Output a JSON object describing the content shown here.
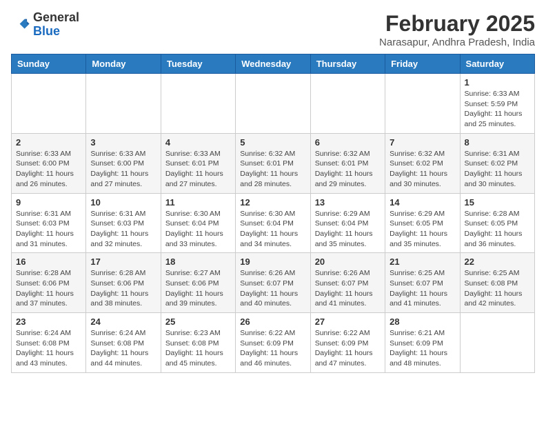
{
  "header": {
    "logo": {
      "general": "General",
      "blue": "Blue"
    },
    "title": "February 2025",
    "location": "Narasapur, Andhra Pradesh, India"
  },
  "weekdays": [
    "Sunday",
    "Monday",
    "Tuesday",
    "Wednesday",
    "Thursday",
    "Friday",
    "Saturday"
  ],
  "weeks": [
    [
      {
        "day": "",
        "info": ""
      },
      {
        "day": "",
        "info": ""
      },
      {
        "day": "",
        "info": ""
      },
      {
        "day": "",
        "info": ""
      },
      {
        "day": "",
        "info": ""
      },
      {
        "day": "",
        "info": ""
      },
      {
        "day": "1",
        "info": "Sunrise: 6:33 AM\nSunset: 5:59 PM\nDaylight: 11 hours\nand 25 minutes."
      }
    ],
    [
      {
        "day": "2",
        "info": "Sunrise: 6:33 AM\nSunset: 6:00 PM\nDaylight: 11 hours\nand 26 minutes."
      },
      {
        "day": "3",
        "info": "Sunrise: 6:33 AM\nSunset: 6:00 PM\nDaylight: 11 hours\nand 27 minutes."
      },
      {
        "day": "4",
        "info": "Sunrise: 6:33 AM\nSunset: 6:01 PM\nDaylight: 11 hours\nand 27 minutes."
      },
      {
        "day": "5",
        "info": "Sunrise: 6:32 AM\nSunset: 6:01 PM\nDaylight: 11 hours\nand 28 minutes."
      },
      {
        "day": "6",
        "info": "Sunrise: 6:32 AM\nSunset: 6:01 PM\nDaylight: 11 hours\nand 29 minutes."
      },
      {
        "day": "7",
        "info": "Sunrise: 6:32 AM\nSunset: 6:02 PM\nDaylight: 11 hours\nand 30 minutes."
      },
      {
        "day": "8",
        "info": "Sunrise: 6:31 AM\nSunset: 6:02 PM\nDaylight: 11 hours\nand 30 minutes."
      }
    ],
    [
      {
        "day": "9",
        "info": "Sunrise: 6:31 AM\nSunset: 6:03 PM\nDaylight: 11 hours\nand 31 minutes."
      },
      {
        "day": "10",
        "info": "Sunrise: 6:31 AM\nSunset: 6:03 PM\nDaylight: 11 hours\nand 32 minutes."
      },
      {
        "day": "11",
        "info": "Sunrise: 6:30 AM\nSunset: 6:04 PM\nDaylight: 11 hours\nand 33 minutes."
      },
      {
        "day": "12",
        "info": "Sunrise: 6:30 AM\nSunset: 6:04 PM\nDaylight: 11 hours\nand 34 minutes."
      },
      {
        "day": "13",
        "info": "Sunrise: 6:29 AM\nSunset: 6:04 PM\nDaylight: 11 hours\nand 35 minutes."
      },
      {
        "day": "14",
        "info": "Sunrise: 6:29 AM\nSunset: 6:05 PM\nDaylight: 11 hours\nand 35 minutes."
      },
      {
        "day": "15",
        "info": "Sunrise: 6:28 AM\nSunset: 6:05 PM\nDaylight: 11 hours\nand 36 minutes."
      }
    ],
    [
      {
        "day": "16",
        "info": "Sunrise: 6:28 AM\nSunset: 6:06 PM\nDaylight: 11 hours\nand 37 minutes."
      },
      {
        "day": "17",
        "info": "Sunrise: 6:28 AM\nSunset: 6:06 PM\nDaylight: 11 hours\nand 38 minutes."
      },
      {
        "day": "18",
        "info": "Sunrise: 6:27 AM\nSunset: 6:06 PM\nDaylight: 11 hours\nand 39 minutes."
      },
      {
        "day": "19",
        "info": "Sunrise: 6:26 AM\nSunset: 6:07 PM\nDaylight: 11 hours\nand 40 minutes."
      },
      {
        "day": "20",
        "info": "Sunrise: 6:26 AM\nSunset: 6:07 PM\nDaylight: 11 hours\nand 41 minutes."
      },
      {
        "day": "21",
        "info": "Sunrise: 6:25 AM\nSunset: 6:07 PM\nDaylight: 11 hours\nand 41 minutes."
      },
      {
        "day": "22",
        "info": "Sunrise: 6:25 AM\nSunset: 6:08 PM\nDaylight: 11 hours\nand 42 minutes."
      }
    ],
    [
      {
        "day": "23",
        "info": "Sunrise: 6:24 AM\nSunset: 6:08 PM\nDaylight: 11 hours\nand 43 minutes."
      },
      {
        "day": "24",
        "info": "Sunrise: 6:24 AM\nSunset: 6:08 PM\nDaylight: 11 hours\nand 44 minutes."
      },
      {
        "day": "25",
        "info": "Sunrise: 6:23 AM\nSunset: 6:08 PM\nDaylight: 11 hours\nand 45 minutes."
      },
      {
        "day": "26",
        "info": "Sunrise: 6:22 AM\nSunset: 6:09 PM\nDaylight: 11 hours\nand 46 minutes."
      },
      {
        "day": "27",
        "info": "Sunrise: 6:22 AM\nSunset: 6:09 PM\nDaylight: 11 hours\nand 47 minutes."
      },
      {
        "day": "28",
        "info": "Sunrise: 6:21 AM\nSunset: 6:09 PM\nDaylight: 11 hours\nand 48 minutes."
      },
      {
        "day": "",
        "info": ""
      }
    ]
  ]
}
